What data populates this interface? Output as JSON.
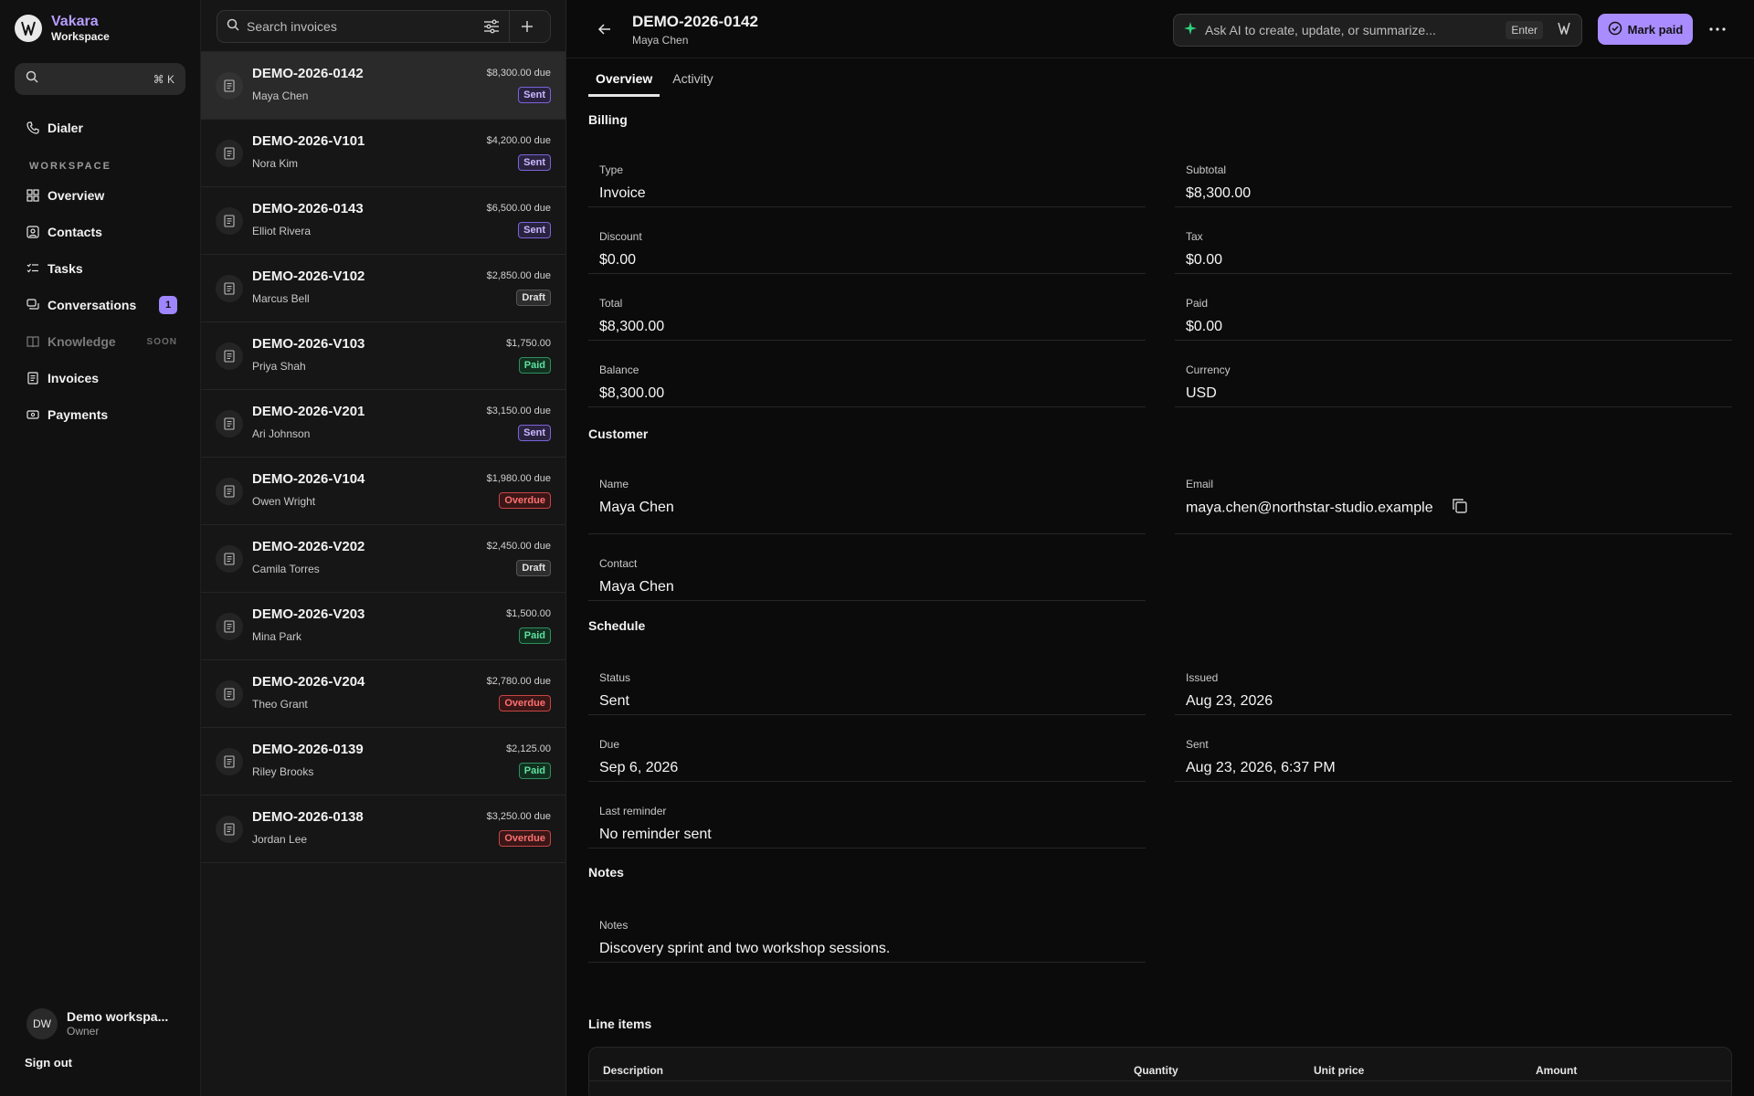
{
  "brand": {
    "name": "Vakara",
    "sub": "Workspace"
  },
  "sidebar": {
    "search_kbd": "⌘ K",
    "dialer": "Dialer",
    "section": "WORKSPACE",
    "items": [
      {
        "label": "Overview",
        "icon": "grid-icon"
      },
      {
        "label": "Contacts",
        "icon": "contact-icon"
      },
      {
        "label": "Tasks",
        "icon": "tasks-icon"
      },
      {
        "label": "Conversations",
        "icon": "chat-icon",
        "badge": "1"
      },
      {
        "label": "Knowledge",
        "icon": "book-icon",
        "soon": "SOON"
      },
      {
        "label": "Invoices",
        "icon": "invoice-icon"
      },
      {
        "label": "Payments",
        "icon": "payment-icon"
      }
    ],
    "user": {
      "initials": "DW",
      "name": "Demo workspa...",
      "role": "Owner"
    },
    "signout": "Sign out"
  },
  "list": {
    "search_placeholder": "Search invoices",
    "invoices": [
      {
        "number": "DEMO-2026-0142",
        "customer": "Maya Chen",
        "amount": "$8,300.00 due",
        "status": "Sent",
        "kind": "sent"
      },
      {
        "number": "DEMO-2026-V101",
        "customer": "Nora Kim",
        "amount": "$4,200.00 due",
        "status": "Sent",
        "kind": "sent"
      },
      {
        "number": "DEMO-2026-0143",
        "customer": "Elliot Rivera",
        "amount": "$6,500.00 due",
        "status": "Sent",
        "kind": "sent"
      },
      {
        "number": "DEMO-2026-V102",
        "customer": "Marcus Bell",
        "amount": "$2,850.00 due",
        "status": "Draft",
        "kind": "draft"
      },
      {
        "number": "DEMO-2026-V103",
        "customer": "Priya Shah",
        "amount": "$1,750.00",
        "status": "Paid",
        "kind": "paid"
      },
      {
        "number": "DEMO-2026-V201",
        "customer": "Ari Johnson",
        "amount": "$3,150.00 due",
        "status": "Sent",
        "kind": "sent"
      },
      {
        "number": "DEMO-2026-V104",
        "customer": "Owen Wright",
        "amount": "$1,980.00 due",
        "status": "Overdue",
        "kind": "overdue"
      },
      {
        "number": "DEMO-2026-V202",
        "customer": "Camila Torres",
        "amount": "$2,450.00 due",
        "status": "Draft",
        "kind": "draft"
      },
      {
        "number": "DEMO-2026-V203",
        "customer": "Mina Park",
        "amount": "$1,500.00",
        "status": "Paid",
        "kind": "paid"
      },
      {
        "number": "DEMO-2026-V204",
        "customer": "Theo Grant",
        "amount": "$2,780.00 due",
        "status": "Overdue",
        "kind": "overdue"
      },
      {
        "number": "DEMO-2026-0139",
        "customer": "Riley Brooks",
        "amount": "$2,125.00",
        "status": "Paid",
        "kind": "paid"
      },
      {
        "number": "DEMO-2026-0138",
        "customer": "Jordan Lee",
        "amount": "$3,250.00 due",
        "status": "Overdue",
        "kind": "overdue"
      }
    ]
  },
  "detail": {
    "title": "DEMO-2026-0142",
    "subtitle": "Maya Chen",
    "ai_placeholder": "Ask AI to create, update, or summarize...",
    "ai_enter": "Enter",
    "mark_paid": "Mark paid",
    "tabs": [
      "Overview",
      "Activity"
    ],
    "billing": {
      "title": "Billing",
      "type_label": "Type",
      "type": "Invoice",
      "subtotal_label": "Subtotal",
      "subtotal": "$8,300.00",
      "discount_label": "Discount",
      "discount": "$0.00",
      "tax_label": "Tax",
      "tax": "$0.00",
      "total_label": "Total",
      "total": "$8,300.00",
      "paid_label": "Paid",
      "paid": "$0.00",
      "balance_label": "Balance",
      "balance": "$8,300.00",
      "currency_label": "Currency",
      "currency": "USD"
    },
    "customer": {
      "title": "Customer",
      "name_label": "Name",
      "name": "Maya Chen",
      "email_label": "Email",
      "email": "maya.chen@northstar-studio.example",
      "contact_label": "Contact",
      "contact": "Maya Chen"
    },
    "schedule": {
      "title": "Schedule",
      "status_label": "Status",
      "status": "Sent",
      "issued_label": "Issued",
      "issued": "Aug 23, 2026",
      "due_label": "Due",
      "due": "Sep 6, 2026",
      "sent_label": "Sent",
      "sent": "Aug 23, 2026, 6:37 PM",
      "reminder_label": "Last reminder",
      "reminder": "No reminder sent"
    },
    "notes": {
      "title": "Notes",
      "label": "Notes",
      "value": "Discovery sprint and two workshop sessions."
    },
    "line_items": {
      "title": "Line items",
      "columns": [
        "Description",
        "Quantity",
        "Unit price",
        "Amount"
      ]
    }
  },
  "colors": {
    "accent": "#a98cff",
    "sent": "#c9b8ff",
    "paid": "#5fe0a0",
    "overdue": "#ff7070",
    "background": "#0b0b0b"
  }
}
